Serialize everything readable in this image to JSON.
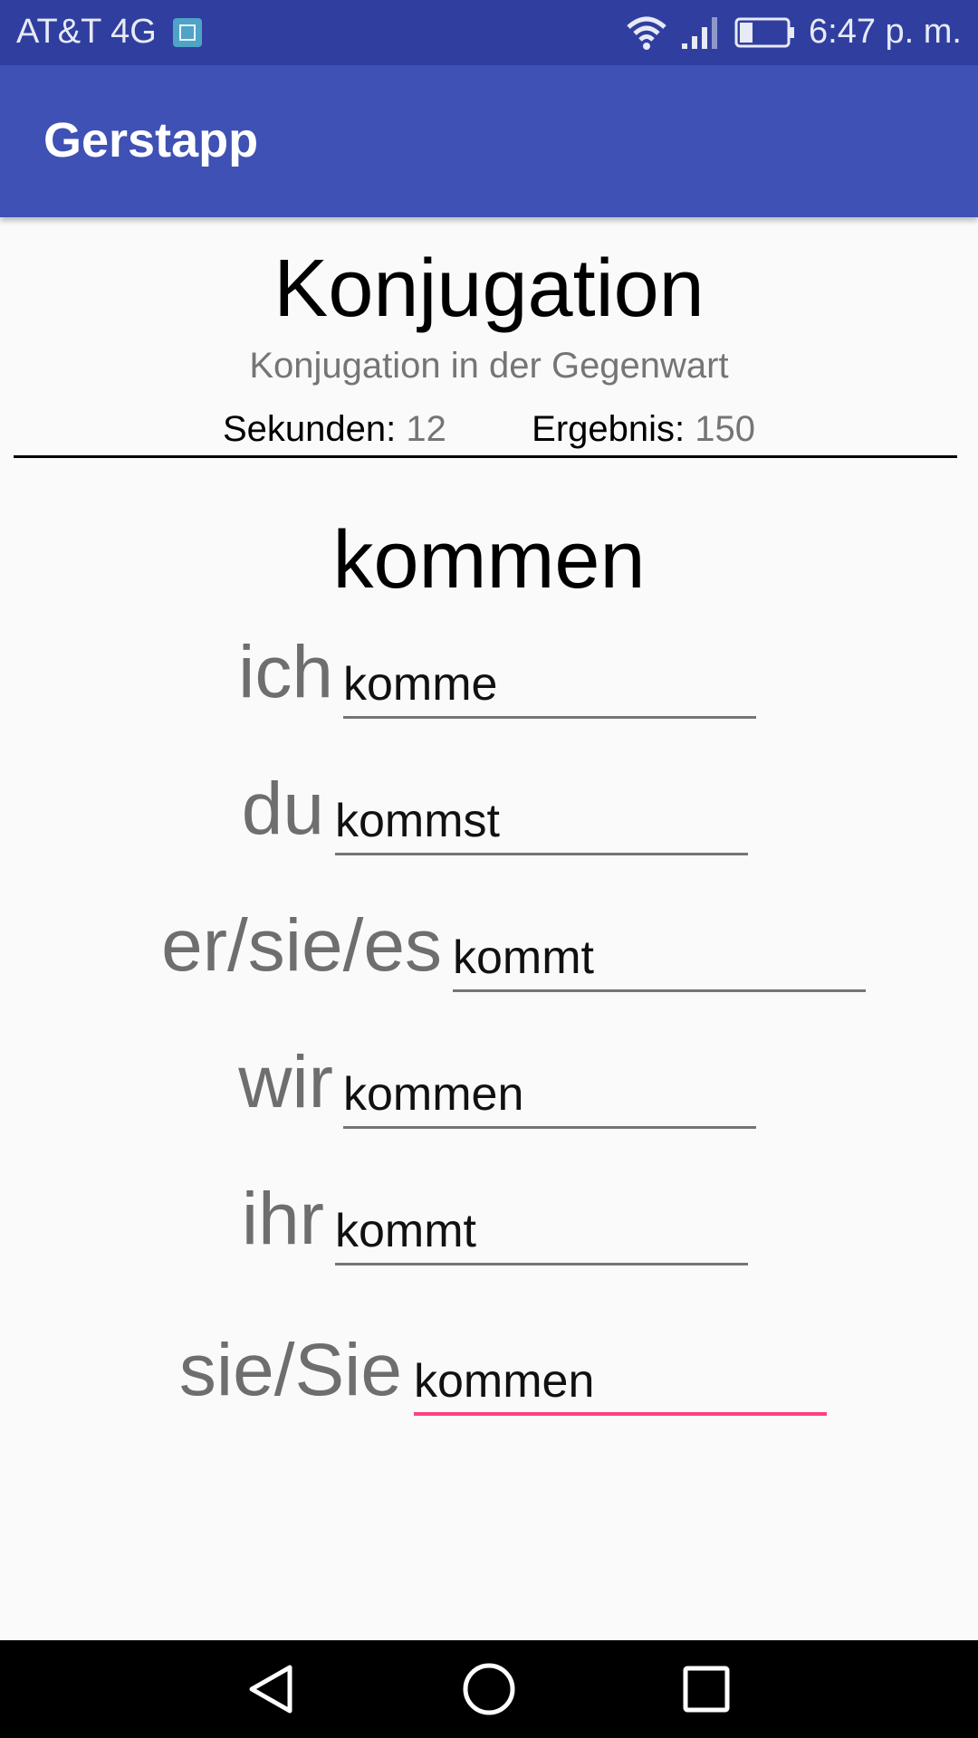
{
  "status_bar": {
    "carrier": "AT&T 4G",
    "time": "6:47 p. m.",
    "icons": [
      "image-notification-icon",
      "wifi-icon",
      "cell-signal-icon",
      "battery-icon"
    ]
  },
  "app_bar": {
    "title": "Gerstapp",
    "background_color": "#3f51b5"
  },
  "header": {
    "title": "Konjugation",
    "subtitle": "Konjugation in der Gegenwart",
    "seconds_label": "Sekunden:",
    "seconds_value": "12",
    "score_label": "Ergebnis:",
    "score_value": "150"
  },
  "verb": "kommen",
  "conjugations": [
    {
      "pronoun": "ich",
      "answer": "komme"
    },
    {
      "pronoun": "du",
      "answer": "kommst"
    },
    {
      "pronoun": "er/sie/es",
      "answer": "kommt"
    },
    {
      "pronoun": "wir",
      "answer": "kommen"
    },
    {
      "pronoun": "ihr",
      "answer": "kommt"
    },
    {
      "pronoun": "sie/Sie",
      "answer": "kommen"
    }
  ],
  "accent_color": "#ff4081",
  "nav_bar": {
    "icons": [
      "back-icon",
      "home-icon",
      "recents-icon"
    ]
  }
}
